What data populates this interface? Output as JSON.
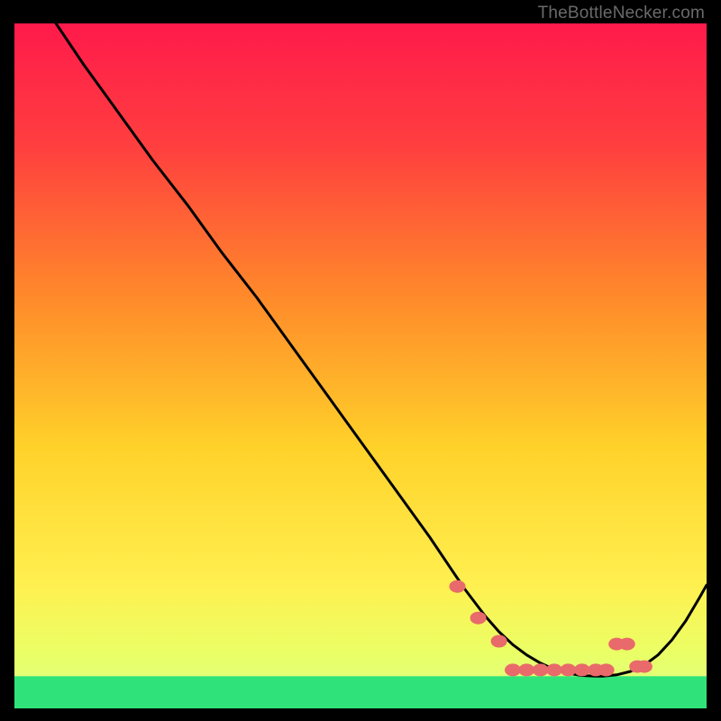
{
  "watermark": "TheBottleNecker.com",
  "chart_data": {
    "type": "line",
    "title": "",
    "xlabel": "",
    "ylabel": "",
    "xlim": [
      0,
      100
    ],
    "ylim": [
      0,
      100
    ],
    "grid": false,
    "series": [
      {
        "name": "curve",
        "x": [
          6,
          10,
          15,
          20,
          25,
          30,
          35,
          40,
          45,
          50,
          55,
          60,
          63,
          65,
          68,
          70,
          72,
          74,
          76,
          78,
          80,
          82,
          84,
          85,
          87,
          89,
          91,
          93,
          95,
          97,
          99,
          100
        ],
        "y": [
          100,
          94,
          87,
          80,
          73.5,
          66.5,
          60,
          53,
          46,
          39,
          32,
          25,
          20.5,
          17.5,
          13.5,
          11.2,
          9.3,
          7.8,
          6.6,
          5.7,
          5.1,
          4.8,
          4.7,
          4.7,
          4.9,
          5.4,
          6.3,
          7.8,
          10,
          12.8,
          16.2,
          18
        ]
      }
    ],
    "markers": {
      "name": "highlight-dots",
      "x": [
        64,
        67,
        70,
        72,
        74,
        76,
        78,
        80,
        82,
        84,
        85.5,
        87,
        88.5,
        90,
        91
      ],
      "y": [
        17.8,
        13.2,
        9.8,
        5.6,
        5.6,
        5.6,
        5.6,
        5.6,
        5.6,
        5.6,
        5.6,
        9.4,
        9.4,
        6.1,
        6.1
      ]
    },
    "background_gradient": {
      "top": "#ff1a4b",
      "mid": "#ffe433",
      "bottom_band": "#2fe37a"
    }
  }
}
